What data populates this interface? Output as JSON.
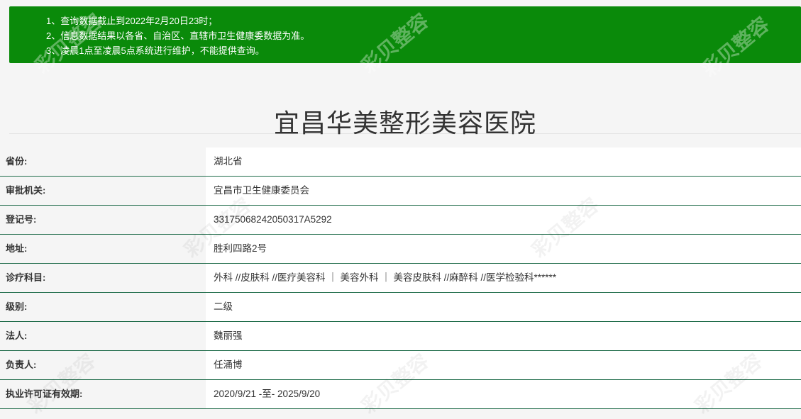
{
  "notice": {
    "lines": [
      "1、查询数据截止到2022年2月20日23时；",
      "2、信息数据结果以各省、自治区、直辖市卫生健康委数据为准。",
      "3、凌晨1点至凌晨5点系统进行维护，不能提供查询。"
    ]
  },
  "hospital": {
    "title": "宜昌华美整形美容医院"
  },
  "info": [
    {
      "label": "省份:",
      "value": "湖北省"
    },
    {
      "label": "审批机关:",
      "value": "宜昌市卫生健康委员会"
    },
    {
      "label": "登记号:",
      "value": "33175068242050317A5292"
    },
    {
      "label": "地址:",
      "value": "胜利四路2号"
    },
    {
      "label": "诊疗科目:",
      "value": "外科 //皮肤科 //医疗美容科 ｜ 美容外科 ｜ 美容皮肤科 //麻醉科 //医学检验科******"
    },
    {
      "label": "级别:",
      "value": "二级"
    },
    {
      "label": "法人:",
      "value": "魏丽强"
    },
    {
      "label": "负责人:",
      "value": "任涌博"
    },
    {
      "label": "执业许可证有效期:",
      "value": "2020/9/21 -至- 2025/9/20"
    }
  ],
  "watermark": {
    "text": "彩贝整容"
  },
  "colors": {
    "notice_bg": "#0a8a0a",
    "row_border": "#1e6b49"
  }
}
